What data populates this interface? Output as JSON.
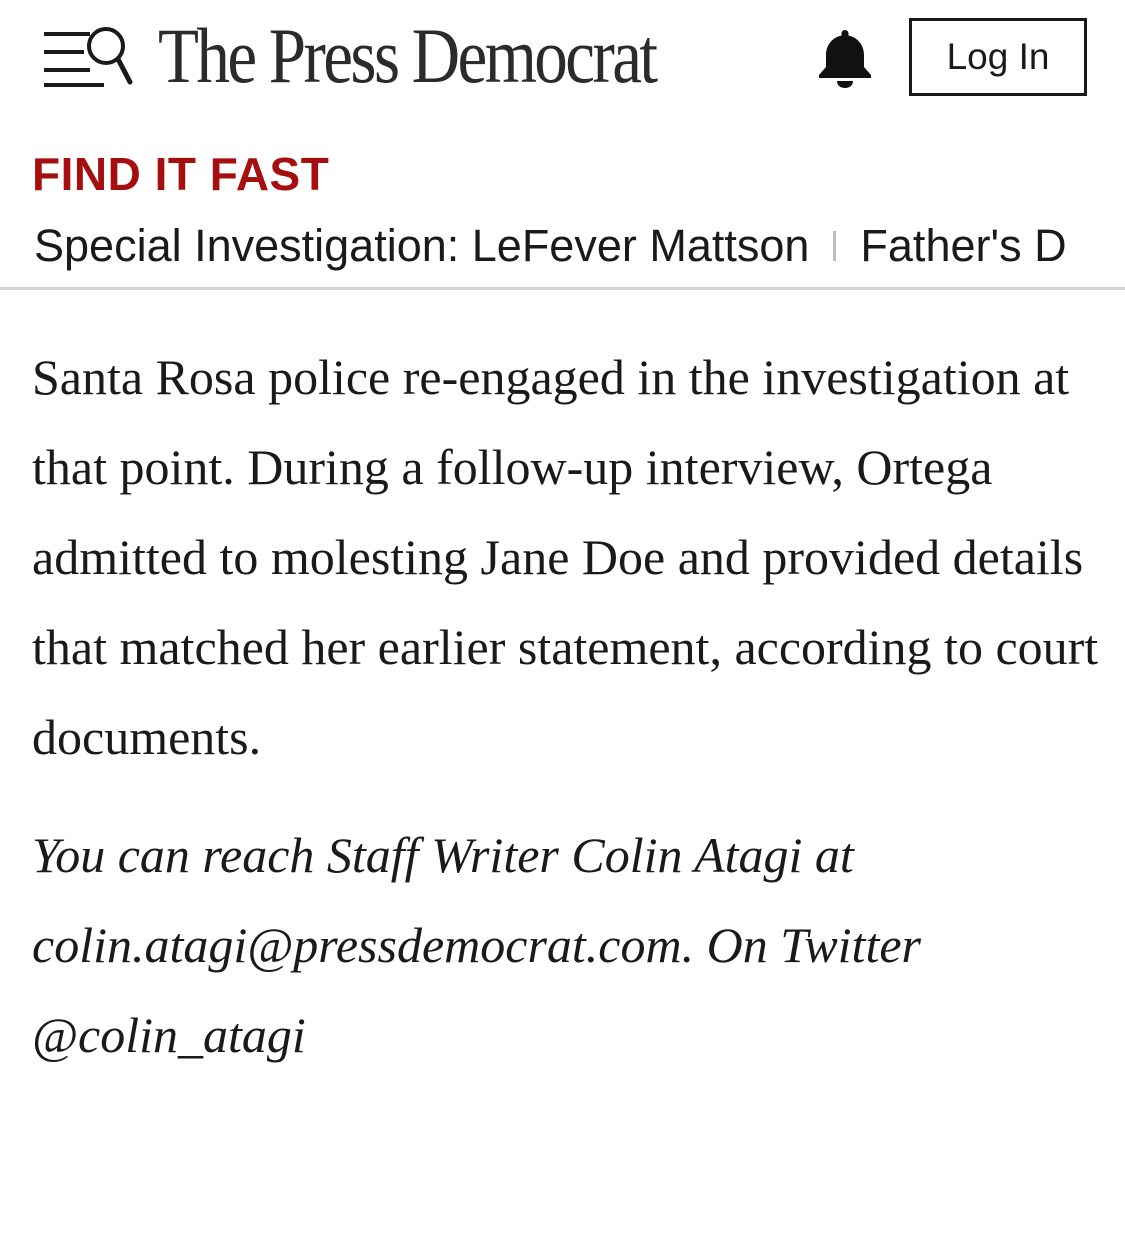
{
  "header": {
    "menu_icon": "menu-search-icon",
    "logo_text": "The Press Democrat",
    "bell_icon": "bell-icon",
    "login_label": "Log In"
  },
  "find_it_fast": {
    "heading": "FIND IT FAST",
    "links": [
      {
        "label": "Special Investigation: LeFever Mattson"
      },
      {
        "label": "Father's D"
      }
    ]
  },
  "article": {
    "paragraph": "Santa Rosa police re-engaged in the investigation at that point. During a follow-up interview, Ortega admitted to molesting Jane Doe and provided details that matched her earlier statement, according to court documents.",
    "signoff": {
      "prefix": "You can reach Staff Writer Colin Atagi at ",
      "email": "colin.atagi@pressdemocrat.com",
      "middle": ". On Twitter ",
      "twitter": "@colin_atagi"
    }
  },
  "colors": {
    "accent_red": "#a50f0f",
    "text": "#1a1a1a",
    "divider": "#d4d4d4"
  }
}
